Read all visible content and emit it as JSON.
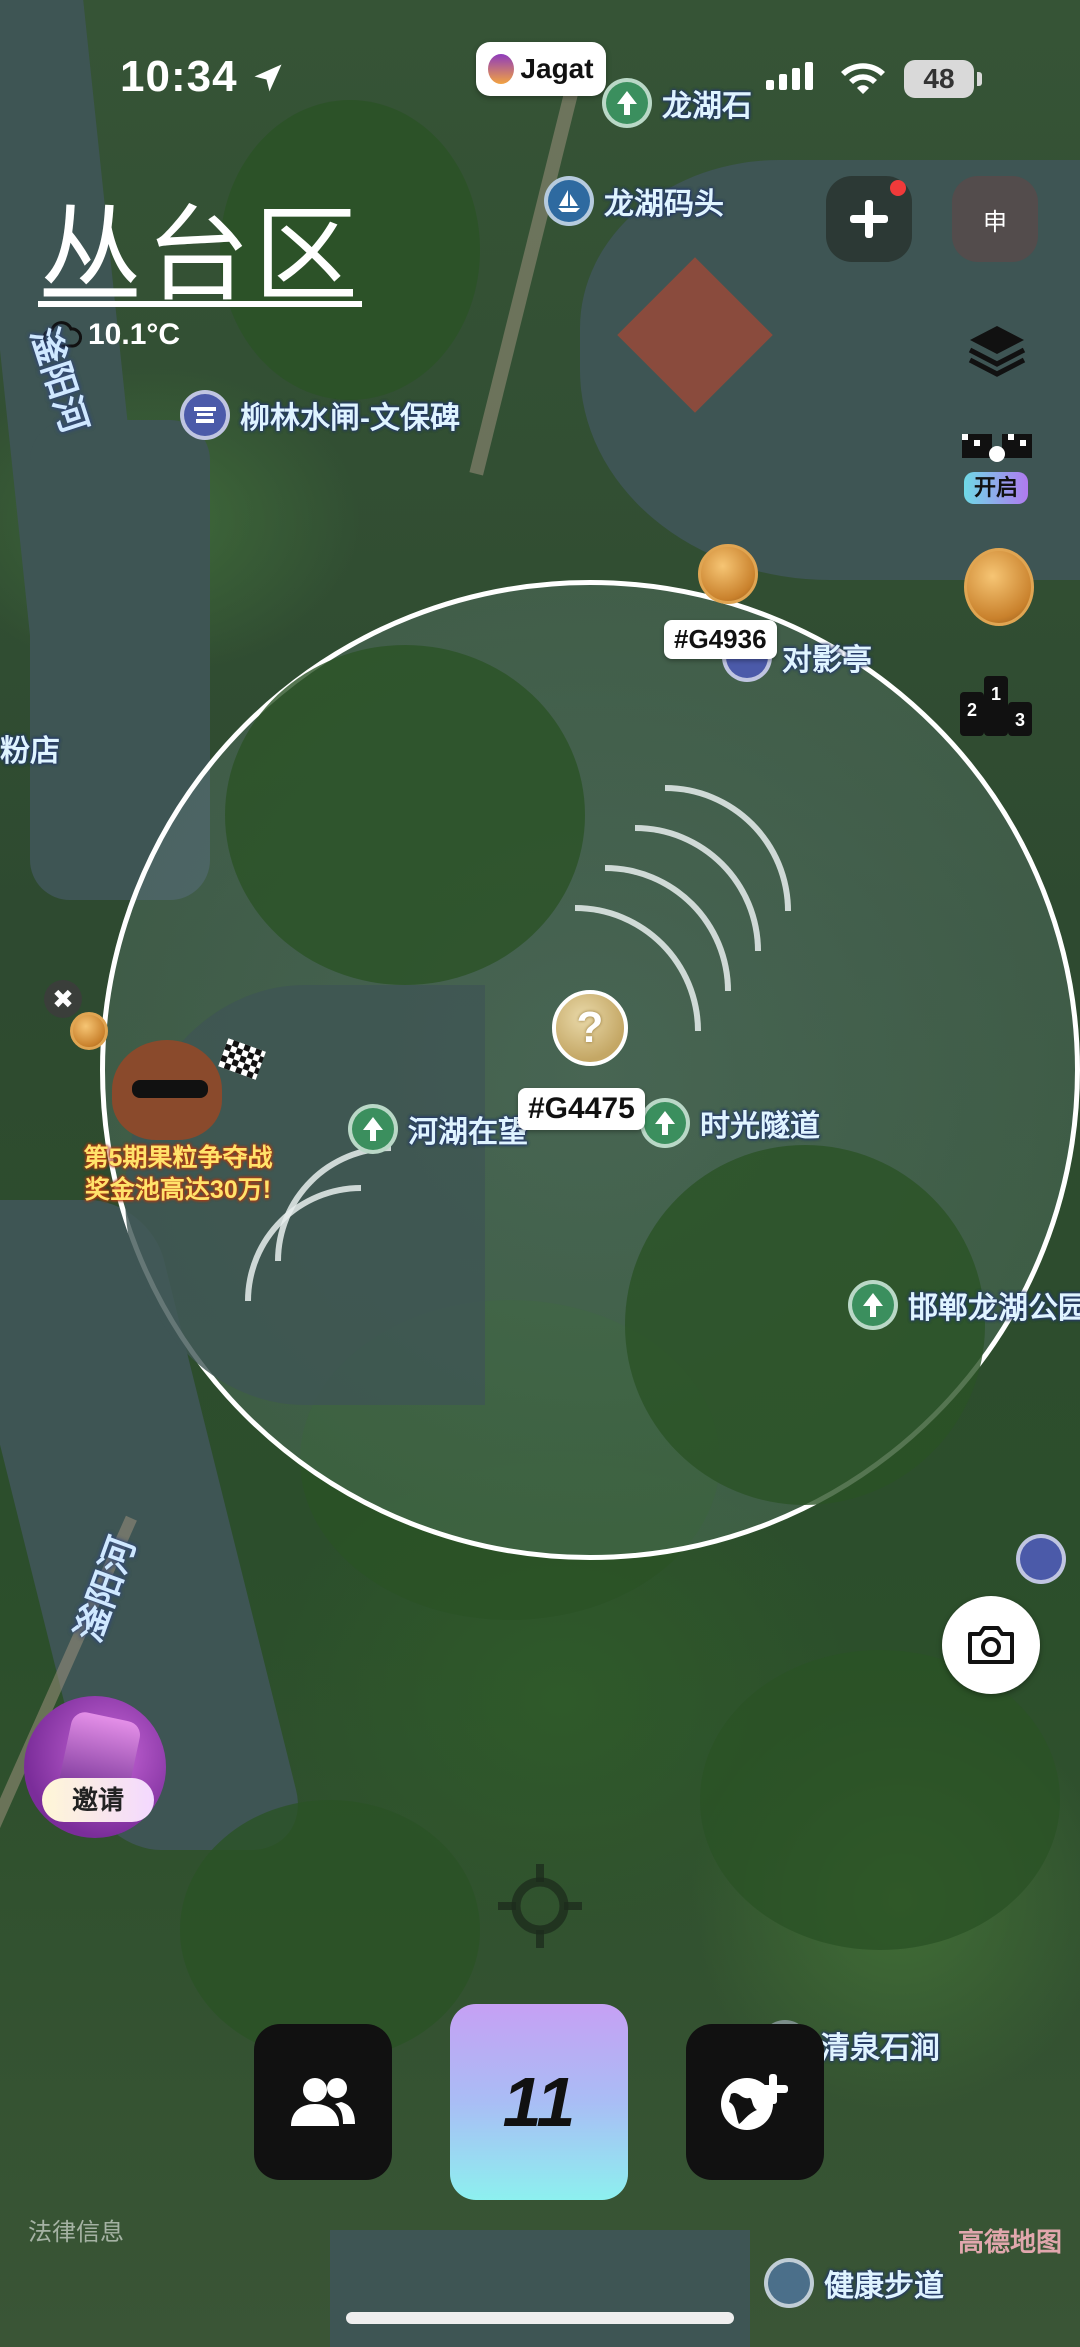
{
  "status_bar": {
    "time": "10:34",
    "battery": "48"
  },
  "app_pill": {
    "label": "Jagat"
  },
  "district": {
    "name": "丛台区",
    "temperature": "10.1°C"
  },
  "pois": {
    "longhu_stone": "龙湖石",
    "longhu_dock": "龙湖码头",
    "liulin_gate": "柳林水闸-文保碑",
    "duiying_pavilion": "对影亭",
    "river_lake": "河湖在望",
    "time_tunnel": "时光隧道",
    "handan_park": "邯郸龙湖公园",
    "qingquan": "清泉石涧",
    "health_walk": "健康步道",
    "partial_shop": "粉店"
  },
  "rivers": {
    "fuyang_upper": "滏阳河",
    "fuyang_lower": "滏阳河"
  },
  "controls": {
    "apply_label": "申",
    "open_label": "开启"
  },
  "tags": {
    "nearby": "#G4936",
    "center": "#G4475"
  },
  "mystery": {
    "symbol": "?"
  },
  "promo": {
    "close": "✖",
    "line1": "第5期果粒争夺战",
    "line2": "奖金池高达30万!"
  },
  "invite": {
    "label": "邀请"
  },
  "bottom_bar": {
    "center_label": "11"
  },
  "footer": {
    "legal": "法律信息",
    "attribution": "高德地图"
  },
  "icons": {
    "location-arrow": "location-arrow-icon",
    "plus": "plus-icon",
    "layers": "layers-icon",
    "ranking": "podium-icon",
    "camera": "camera-icon",
    "friends": "users-icon",
    "globe": "globe-plus-icon",
    "crosshair": "crosshair-icon"
  }
}
